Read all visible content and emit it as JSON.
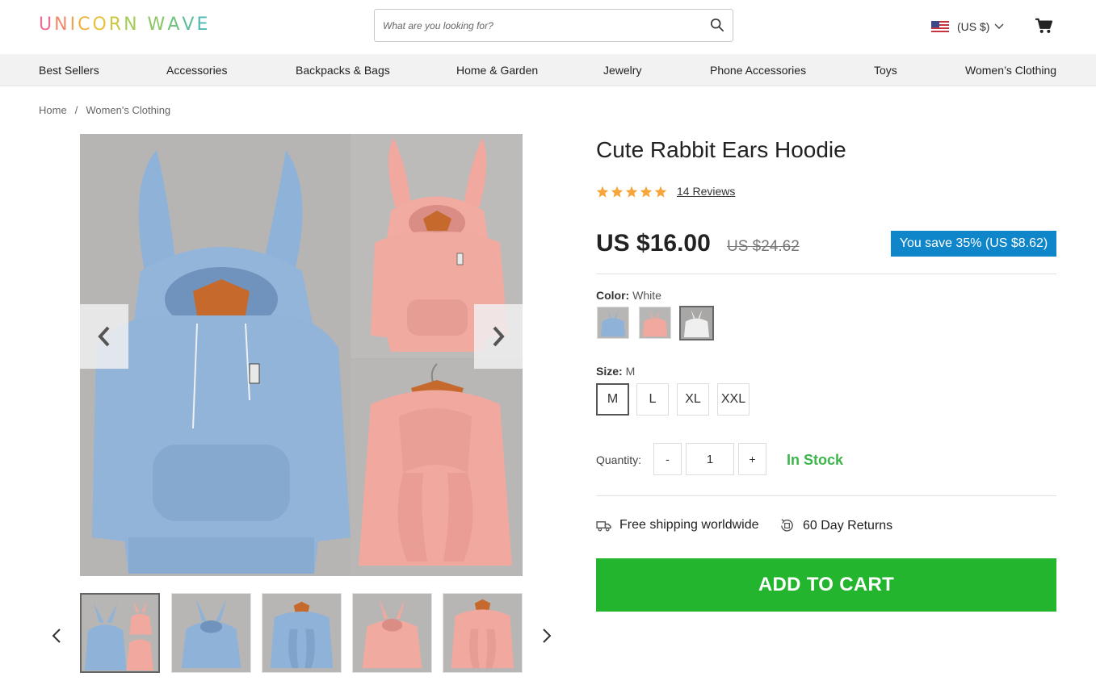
{
  "header": {
    "logo_letters": [
      {
        "ch": "U",
        "color": "#ef6b8f"
      },
      {
        "ch": "N",
        "color": "#f08a6a"
      },
      {
        "ch": "I",
        "color": "#f0a24f"
      },
      {
        "ch": "C",
        "color": "#f0b040"
      },
      {
        "ch": "O",
        "color": "#e7c13a"
      },
      {
        "ch": "R",
        "color": "#c9c83f"
      },
      {
        "ch": "N",
        "color": "#a5cc55"
      },
      {
        "ch": " ",
        "color": "#ffffff"
      },
      {
        "ch": "W",
        "color": "#8bc663"
      },
      {
        "ch": "A",
        "color": "#6fc27c"
      },
      {
        "ch": "V",
        "color": "#5cbf97"
      },
      {
        "ch": "E",
        "color": "#4fbab2"
      }
    ],
    "search_placeholder": "What are you looking for?",
    "currency_label": "(US $)",
    "icons": [
      "search-icon",
      "us-flag-icon",
      "chevron-down-icon",
      "cart-icon"
    ]
  },
  "nav": {
    "items": [
      "Best Sellers",
      "Accessories",
      "Backpacks & Bags",
      "Home & Garden",
      "Jewelry",
      "Phone Accessories",
      "Toys",
      "Women’s Clothing"
    ]
  },
  "breadcrumb": {
    "home": "Home",
    "separator": "/",
    "current": "Women's Clothing"
  },
  "product": {
    "title": "Cute Rabbit Ears Hoodie",
    "rating": 5,
    "reviews_label": "14 Reviews",
    "price": "US $16.00",
    "old_price": "US $24.62",
    "save_label": "You save 35% (US $8.62)",
    "color_label": "Color:",
    "color_value": "White",
    "colors": [
      {
        "name": "Blue",
        "hex": "#8fb2d8"
      },
      {
        "name": "Pink",
        "hex": "#f1a9a0"
      },
      {
        "name": "White",
        "hex": "#eeeeee"
      }
    ],
    "selected_color_index": 2,
    "size_label": "Size:",
    "size_value": "M",
    "sizes": [
      "M",
      "L",
      "XL",
      "XXL"
    ],
    "selected_size_index": 0,
    "quantity_label": "Quantity:",
    "quantity_minus": "-",
    "quantity_value": "1",
    "quantity_plus": "+",
    "stock_label": "In Stock",
    "shipping_label": "Free shipping worldwide",
    "returns_label": "60 Day Returns",
    "add_to_cart": "ADD TO CART"
  },
  "colors": {
    "accent_blue": "#0f86c9",
    "cart_green": "#24b52f",
    "stock_green": "#3cb64a",
    "star_orange": "#f6a53b",
    "hoodie_blue": "#8fb2d8",
    "hoodie_pink": "#f1a9a0"
  }
}
